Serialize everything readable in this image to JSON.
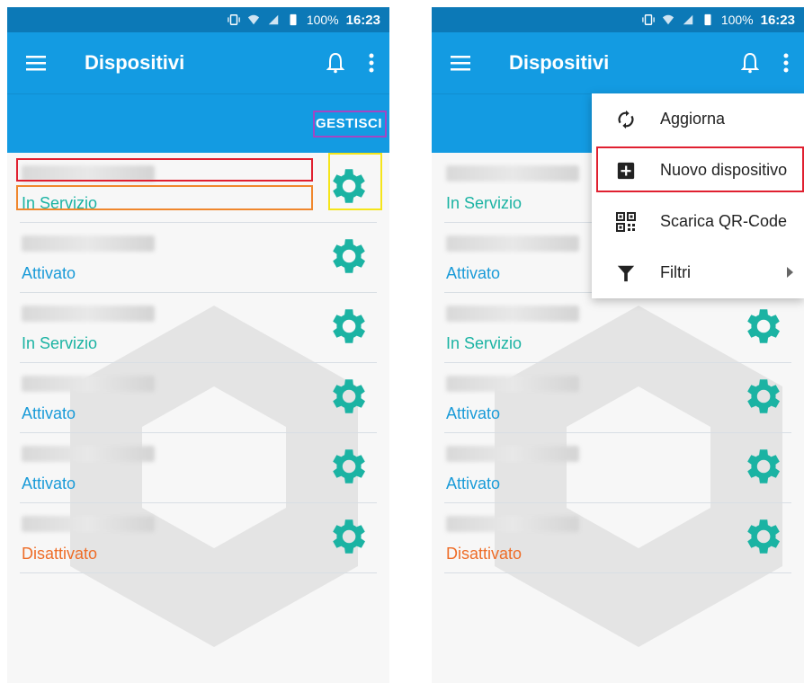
{
  "status_bar": {
    "battery": "100%",
    "time": "16:23"
  },
  "app_bar": {
    "title": "Dispositivi"
  },
  "sub_bar": {
    "manage_label": "GESTISCI"
  },
  "devices": [
    {
      "status": "In Servizio",
      "status_color": "#1bb3a3"
    },
    {
      "status": "Attivato",
      "status_color": "#1a9bd8"
    },
    {
      "status": "In Servizio",
      "status_color": "#1bb3a3"
    },
    {
      "status": "Attivato",
      "status_color": "#1a9bd8"
    },
    {
      "status": "Attivato",
      "status_color": "#1a9bd8"
    },
    {
      "status": "Disattivato",
      "status_color": "#ee6d28"
    }
  ],
  "menu": {
    "items": [
      {
        "label": "Aggiorna",
        "icon": "refresh-icon"
      },
      {
        "label": "Nuovo dispositivo",
        "icon": "add-box-icon"
      },
      {
        "label": "Scarica QR-Code",
        "icon": "qr-code-icon"
      },
      {
        "label": "Filtri",
        "icon": "filter-icon"
      }
    ]
  },
  "colors": {
    "appbar": "#139be2",
    "statusbar": "#0c79b7",
    "gear": "#1bb3a3",
    "highlight_red": "#e02030",
    "highlight_orange": "#f0872d",
    "highlight_yellow": "#f5e51a",
    "highlight_purple": "#a346c4"
  }
}
